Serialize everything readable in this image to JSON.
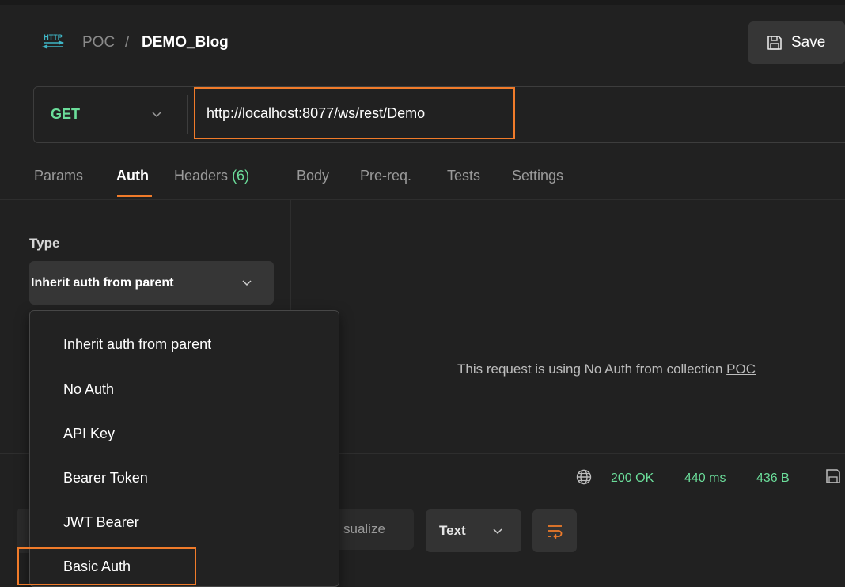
{
  "header": {
    "http_badge": "HTTP",
    "breadcrumb_parent": "POC",
    "breadcrumb_sep": "/",
    "breadcrumb_current": "DEMO_Blog",
    "save_label": "Save"
  },
  "request": {
    "method": "GET",
    "url": "http://localhost:8077/ws/rest/Demo"
  },
  "tabs": [
    {
      "label": "Params"
    },
    {
      "label": "Auth",
      "active": true
    },
    {
      "label": "Headers",
      "count": "(6)"
    },
    {
      "label": "Body"
    },
    {
      "label": "Pre-req."
    },
    {
      "label": "Tests"
    },
    {
      "label": "Settings"
    }
  ],
  "auth": {
    "type_label": "Type",
    "selected": "Inherit auth from parent",
    "message": "This request is using No Auth from collection",
    "collection_link": "POC",
    "options": [
      "Inherit auth from parent",
      "No Auth",
      "API Key",
      "Bearer Token",
      "JWT Bearer",
      "Basic Auth"
    ]
  },
  "response": {
    "status": "200 OK",
    "time": "440 ms",
    "size": "436 B",
    "visualize_label": "sualize",
    "format": "Text"
  },
  "colors": {
    "accent": "#f07b2a",
    "success": "#6bdd9a",
    "background": "#212121"
  }
}
